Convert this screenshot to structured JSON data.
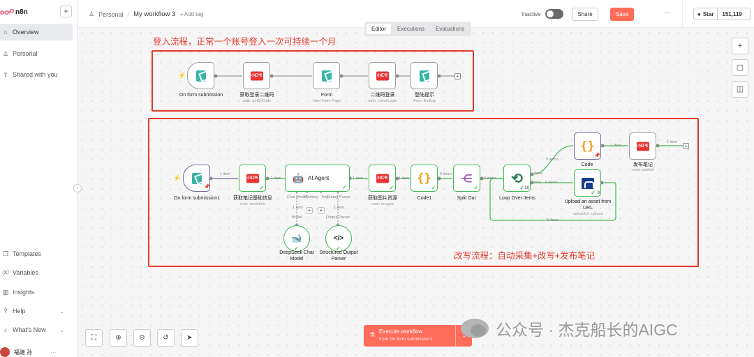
{
  "sidebar": {
    "brand": "n8n",
    "items": [
      {
        "label": "Overview",
        "icon": "home-icon"
      },
      {
        "label": "Personal",
        "icon": "user-icon"
      },
      {
        "label": "Shared with you",
        "icon": "share-icon"
      },
      {
        "label": "Templates",
        "icon": "templates-icon"
      },
      {
        "label": "Variables",
        "icon": "variables-icon"
      },
      {
        "label": "Insights",
        "icon": "insights-icon"
      },
      {
        "label": "Help",
        "icon": "help-icon"
      },
      {
        "label": "What's New",
        "icon": "bell-icon"
      }
    ],
    "user_name": "福建 孙"
  },
  "header": {
    "project": "Personal",
    "workflow_name": "My workflow 3",
    "add_tag": "+ Add tag",
    "status_label": "Inactive",
    "share_label": "Share",
    "save_label": "Save",
    "star_label": "Star",
    "star_count": "151,119"
  },
  "tabs": [
    "Editor",
    "Executions",
    "Evaluations"
  ],
  "annotations": {
    "login_title": "登入流程，正常一个账号登入一次可持续一个月",
    "rewrite_title": "改写流程：自动采集+改写+发布笔记"
  },
  "login_flow": {
    "nodes": [
      {
        "label": "On form submission",
        "sub": ""
      },
      {
        "label": "获取登录二维码",
        "sub": "auth: getQrCode"
      },
      {
        "label": "Form",
        "sub": "Next Form Page"
      },
      {
        "label": "二维码登录",
        "sub": "auth: checkLogin"
      },
      {
        "label": "登陆提示",
        "sub": "Form Ending"
      }
    ]
  },
  "rewrite_flow": {
    "nodes": [
      {
        "label": "On form submission1",
        "sub": ""
      },
      {
        "label": "获取笔记基础信息",
        "sub": "note: basicInfo"
      },
      {
        "label": "AI Agent",
        "sub": ""
      },
      {
        "label": "获取图片资源",
        "sub": "note: images"
      },
      {
        "label": "Code1",
        "sub": ""
      },
      {
        "label": "Split Out",
        "sub": ""
      },
      {
        "label": "Loop Over Items",
        "sub": ""
      },
      {
        "label": "Code",
        "sub": ""
      },
      {
        "label": "发布笔记",
        "sub": "note: publish"
      },
      {
        "label": "Upload an asset from URL",
        "sub": "uploadUrl: upload"
      },
      {
        "label": "DeepSeek Chat Model",
        "sub": ""
      },
      {
        "label": "Structured Output Parser",
        "sub": ""
      }
    ],
    "edge_labels": {
      "item1": "1 item",
      "items9": "9 items",
      "done": "done",
      "loop": "loop",
      "loop_count": "10",
      "upload_count": "9"
    },
    "agent_ports": [
      "Chat Model",
      "Memory",
      "Tool",
      "Output Parser"
    ],
    "sub_ports": [
      "Model",
      "Output Parser"
    ]
  },
  "execute": {
    "label": "Execute workflow",
    "sub": "from On form submission1"
  },
  "watermark": "公众号 · 杰克船长的AIGC"
}
